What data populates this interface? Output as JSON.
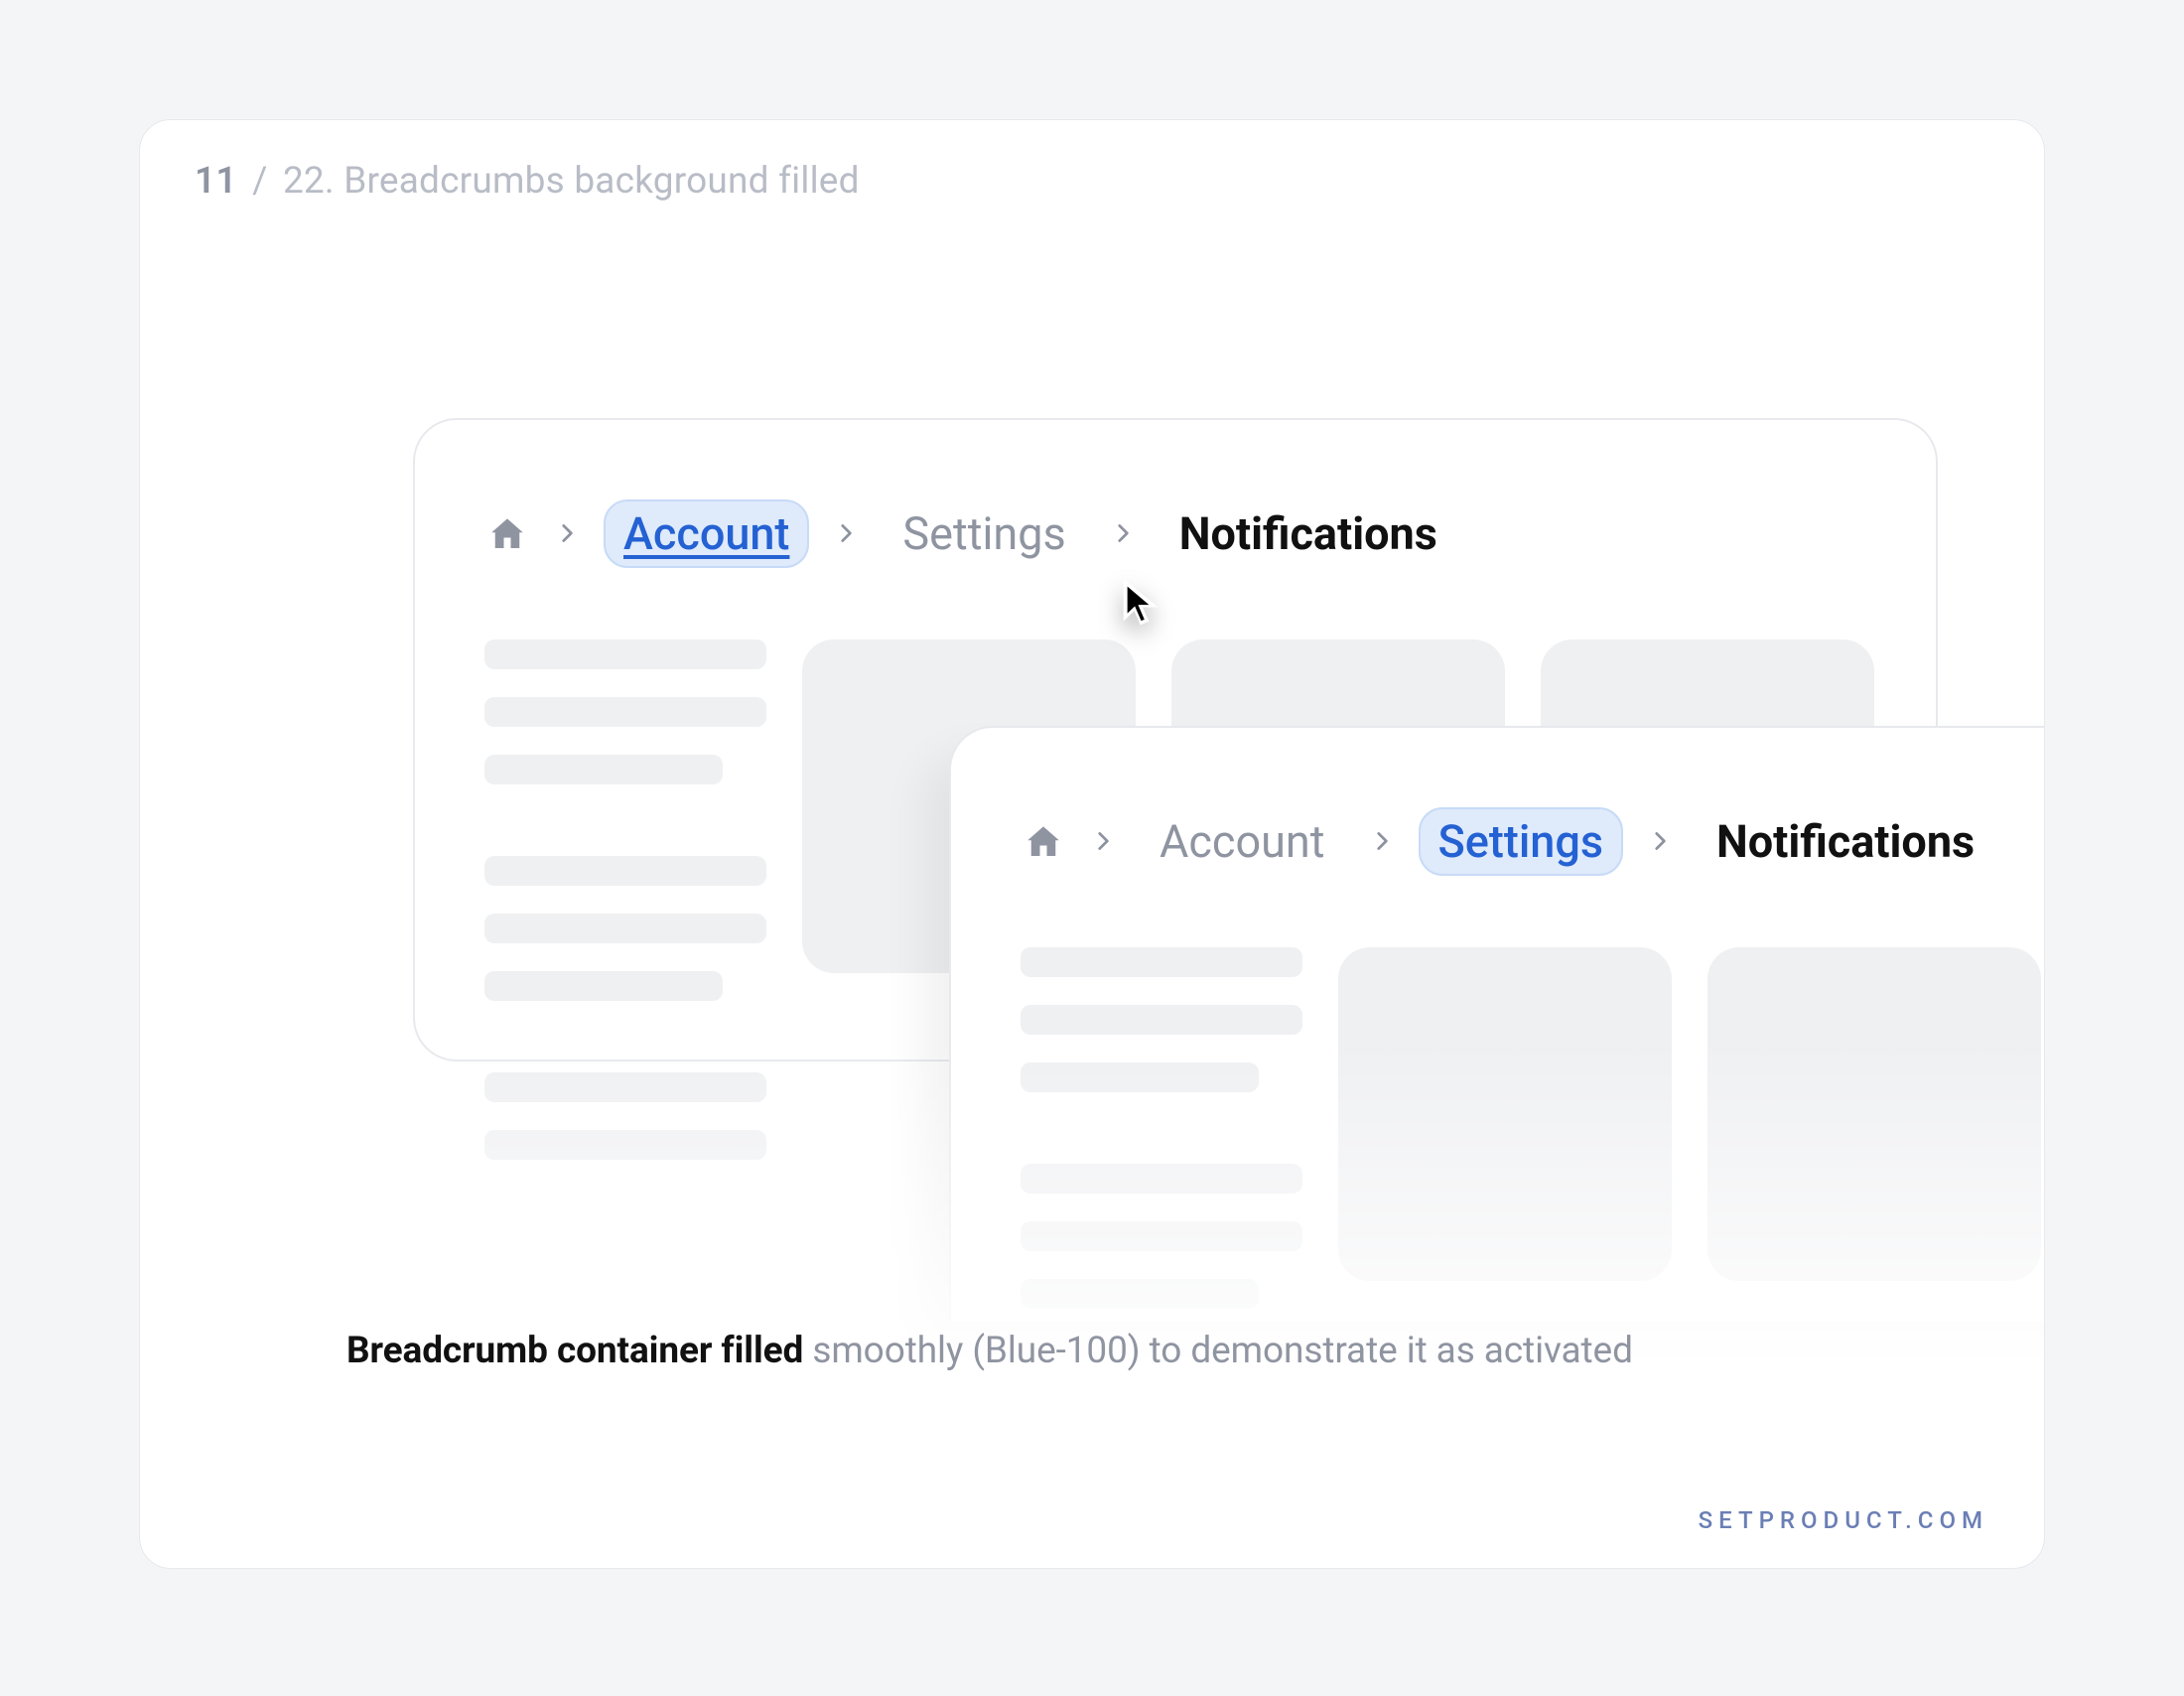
{
  "slide": {
    "index": "11",
    "slash": "/",
    "total_and_title": "22. Breadcrumbs background filled"
  },
  "crumbs": {
    "account": "Account",
    "settings": "Settings",
    "notifications": "Notifications"
  },
  "caption": {
    "strong": "Breadcrumb container filled",
    "dim": " smoothly (Blue-100) to demonstrate it as activated"
  },
  "footer": "SETPRODUCT.COM"
}
